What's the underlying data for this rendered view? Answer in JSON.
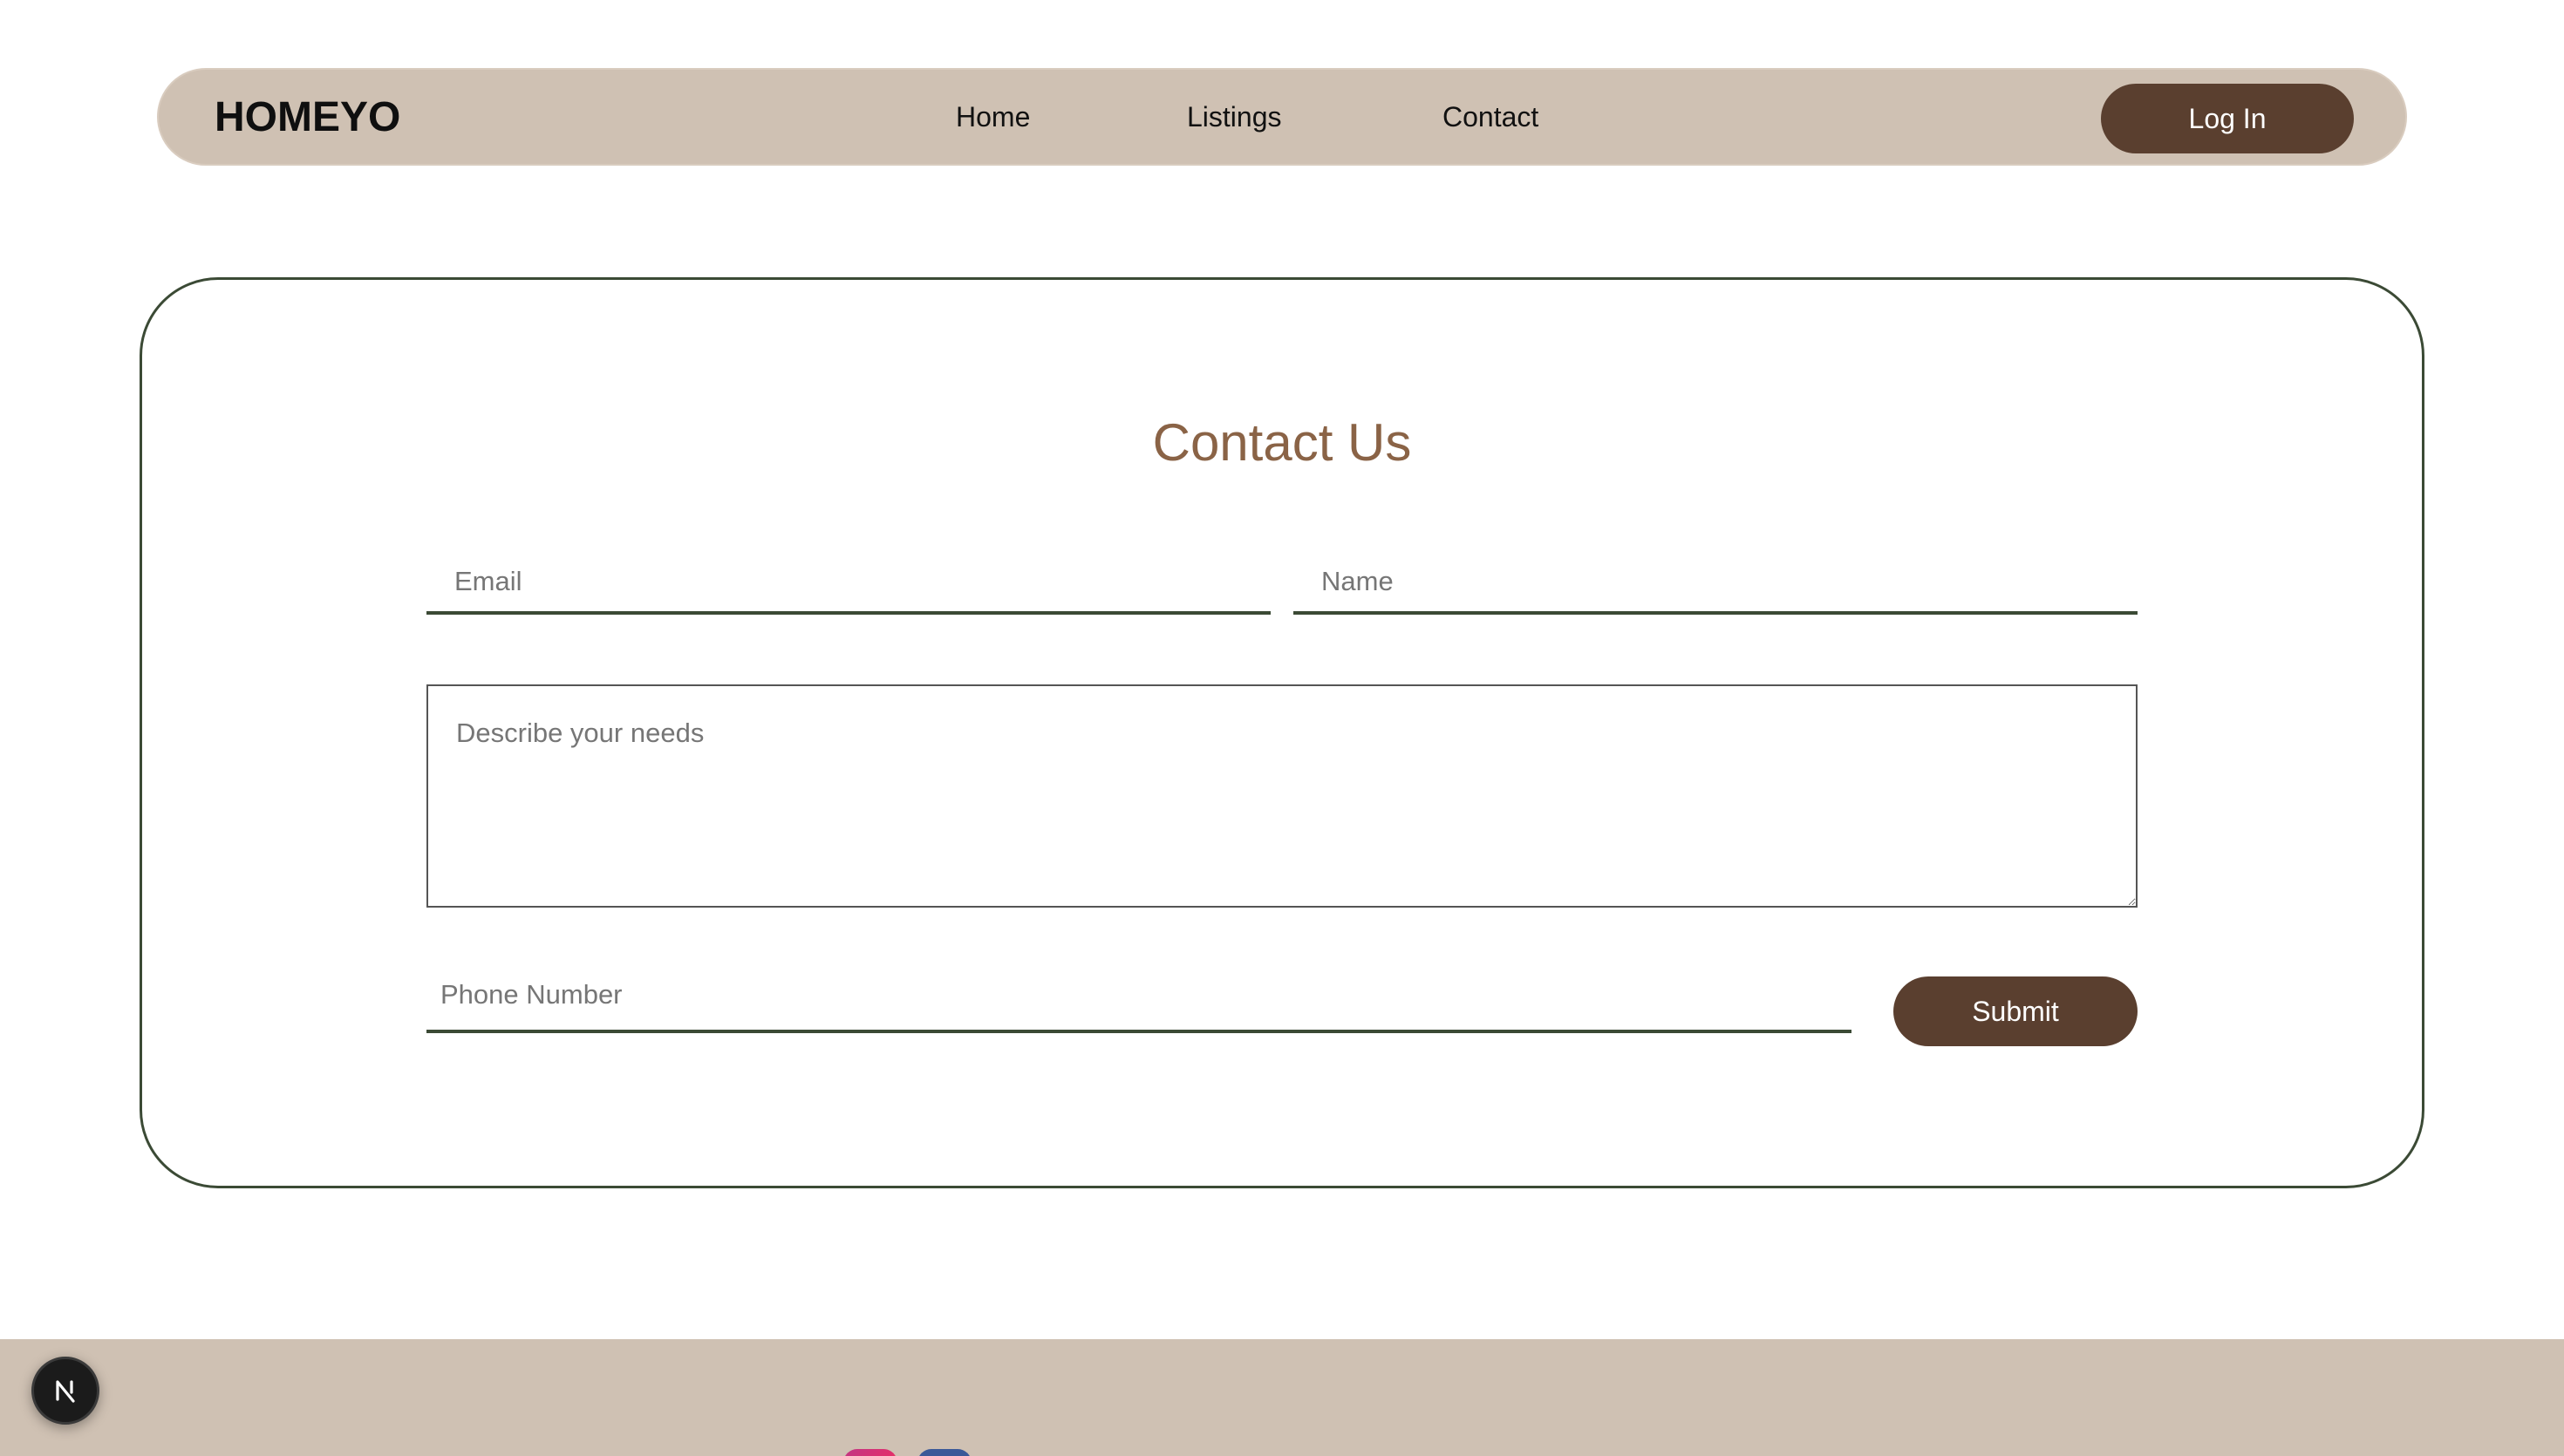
{
  "navbar": {
    "brand": "HOMEYO",
    "links": [
      {
        "label": "Home"
      },
      {
        "label": "Listings"
      },
      {
        "label": "Contact"
      }
    ],
    "login_label": "Log In"
  },
  "contact": {
    "title": "Contact Us",
    "email_placeholder": "Email",
    "name_placeholder": "Name",
    "needs_placeholder": "Describe your needs",
    "phone_placeholder": "Phone Number",
    "submit_label": "Submit"
  },
  "footer": {
    "social_icons": [
      "instagram-icon",
      "facebook-icon"
    ]
  },
  "dev_badge": {
    "icon": "nextjs-icon"
  },
  "colors": {
    "nav_bg": "#cfc1b3",
    "accent_brown": "#5a3f2f",
    "title_brown": "#8a6346",
    "border_green": "#3b4a35"
  }
}
